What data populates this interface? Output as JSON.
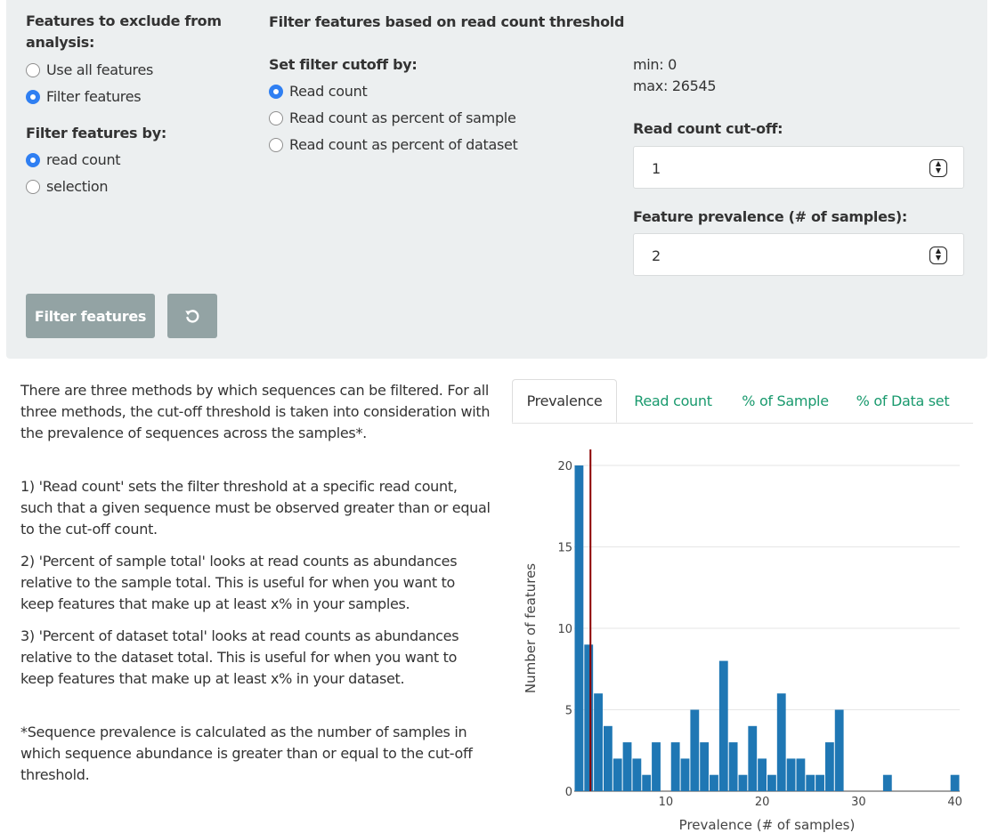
{
  "filter_panel": {
    "exclude_label": "Features to exclude from analysis:",
    "exclude_options": [
      "Use all features",
      "Filter features"
    ],
    "filter_by_label": "Filter features by:",
    "filter_by_options": [
      "read count",
      "selection"
    ],
    "threshold_title": "Filter features based on read count threshold",
    "cutoff_by_label": "Set filter cutoff by:",
    "cutoff_options": [
      "Read count",
      "Read count as percent of sample",
      "Read count as percent of dataset"
    ],
    "min_text": "min: 0",
    "max_text": "max: 26545",
    "cutoff_label": "Read count cut-off:",
    "cutoff_value": "1",
    "prevalence_label": "Feature prevalence (# of samples):",
    "prevalence_value": "2",
    "filter_button": "Filter features",
    "reset_icon": "reset-icon"
  },
  "description": {
    "intro": "There are three methods by which sequences can be filtered. For all three methods, the cut-off threshold is taken into consideration with the prevalence of sequences across the samples*.",
    "method1": "1) 'Read count' sets the filter threshold at a specific read count, such that a given sequence must be observed greater than or equal to the cut-off count.",
    "method2": "2) 'Percent of sample total' looks at read counts as abundances relative to the sample total. This is useful for when you want to keep features that make up at least x% in your samples.",
    "method3": "3) 'Percent of dataset total' looks at read counts as abundances relative to the dataset total. This is useful for when you want to keep features that make up at least x% in your dataset.",
    "footnote": "*Sequence prevalence is calculated as the number of samples in which sequence abundance is greater than or equal to the cut-off threshold."
  },
  "tabs": [
    "Prevalence",
    "Read count",
    "% of Sample",
    "% of Data set"
  ],
  "colors": {
    "bar": "#1f77b4",
    "threshold_line": "#8b0000",
    "tab_link": "#1a9a6e",
    "radio_on": "#2f7ff2"
  },
  "chart_data": {
    "type": "bar",
    "xlabel": "Prevalence (# of samples)",
    "ylabel": "Number of features",
    "xlim": [
      0,
      40
    ],
    "ylim": [
      0,
      20
    ],
    "xticks": [
      10,
      20,
      30,
      40
    ],
    "yticks": [
      0,
      5,
      10,
      15,
      20
    ],
    "threshold_x": 2,
    "x": [
      1,
      2,
      3,
      4,
      5,
      6,
      7,
      8,
      9,
      10,
      11,
      12,
      13,
      14,
      15,
      16,
      17,
      18,
      19,
      20,
      21,
      22,
      23,
      24,
      25,
      26,
      27,
      28,
      29,
      30,
      31,
      32,
      33,
      34,
      35,
      36,
      37,
      38,
      39,
      40
    ],
    "values": [
      20,
      9,
      6,
      4,
      2,
      3,
      2,
      1,
      3,
      0,
      3,
      2,
      5,
      3,
      1,
      8,
      3,
      1,
      4,
      2,
      1,
      6,
      2,
      2,
      1,
      1,
      3,
      5,
      0,
      0,
      0,
      0,
      1,
      0,
      0,
      0,
      0,
      0,
      0,
      1
    ]
  }
}
